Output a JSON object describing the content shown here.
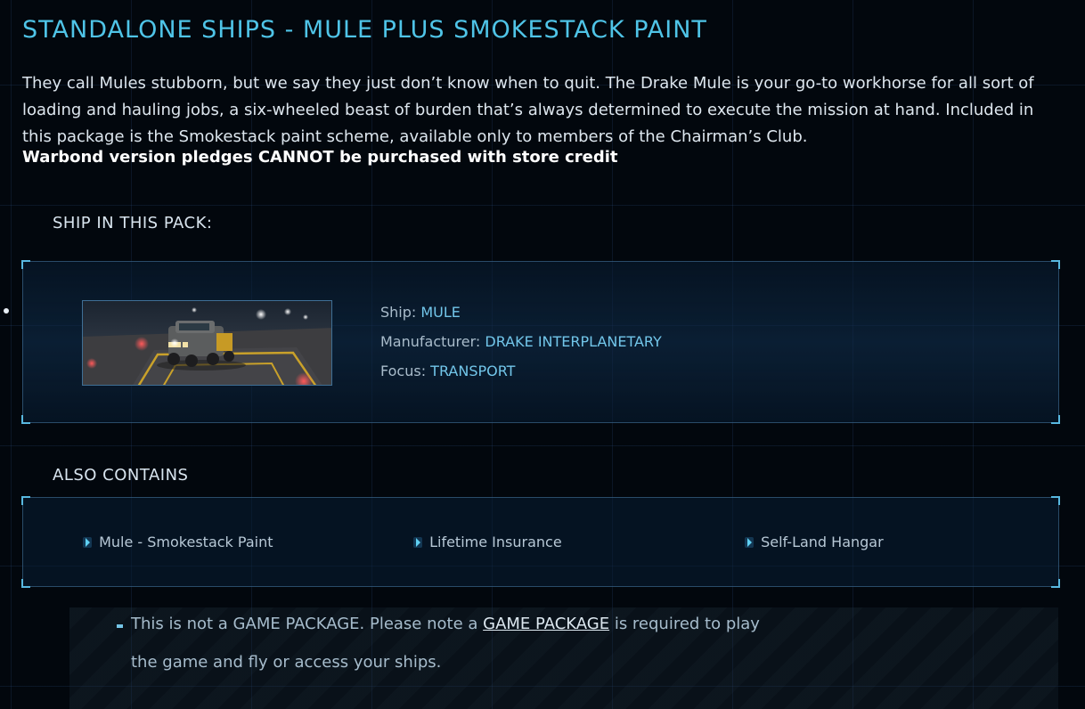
{
  "header": {
    "title": "STANDALONE SHIPS - MULE PLUS SMOKESTACK PAINT",
    "description": "They call Mules stubborn, but we say they just don’t know when to quit. The Drake Mule is your go-to workhorse for all sort of loading and hauling jobs, a six-wheeled beast of burden that’s always determined to execute the mission at hand. Included in this package is the Smokestack paint scheme, available only to members of the Chairman’s Club.",
    "warbond_note": "Warbond version pledges CANNOT be purchased with store credit"
  },
  "ship_section": {
    "heading": "SHIP IN THIS PACK:",
    "ship_label": "Ship: ",
    "ship_value": "MULE",
    "manufacturer_label": "Manufacturer: ",
    "manufacturer_value": "DRAKE INTERPLANETARY",
    "focus_label": "Focus: ",
    "focus_value": "TRANSPORT"
  },
  "contains_section": {
    "heading": "ALSO CONTAINS",
    "items": [
      {
        "label": "Mule - Smokestack Paint"
      },
      {
        "label": "Lifetime Insurance"
      },
      {
        "label": "Self-Land Hangar"
      }
    ]
  },
  "note": {
    "prefix": "This is not a GAME PACKAGE. Please note a ",
    "link": "GAME PACKAGE",
    "suffix": " is required to play",
    "line2": "the game and fly or access your ships."
  },
  "colors": {
    "accent": "#4fc4e7",
    "value_text": "#72c6ea",
    "background": "#02070d"
  },
  "icons": {
    "contains_bullet": "chevron-right-icon",
    "note_bullet": "dash-icon"
  }
}
